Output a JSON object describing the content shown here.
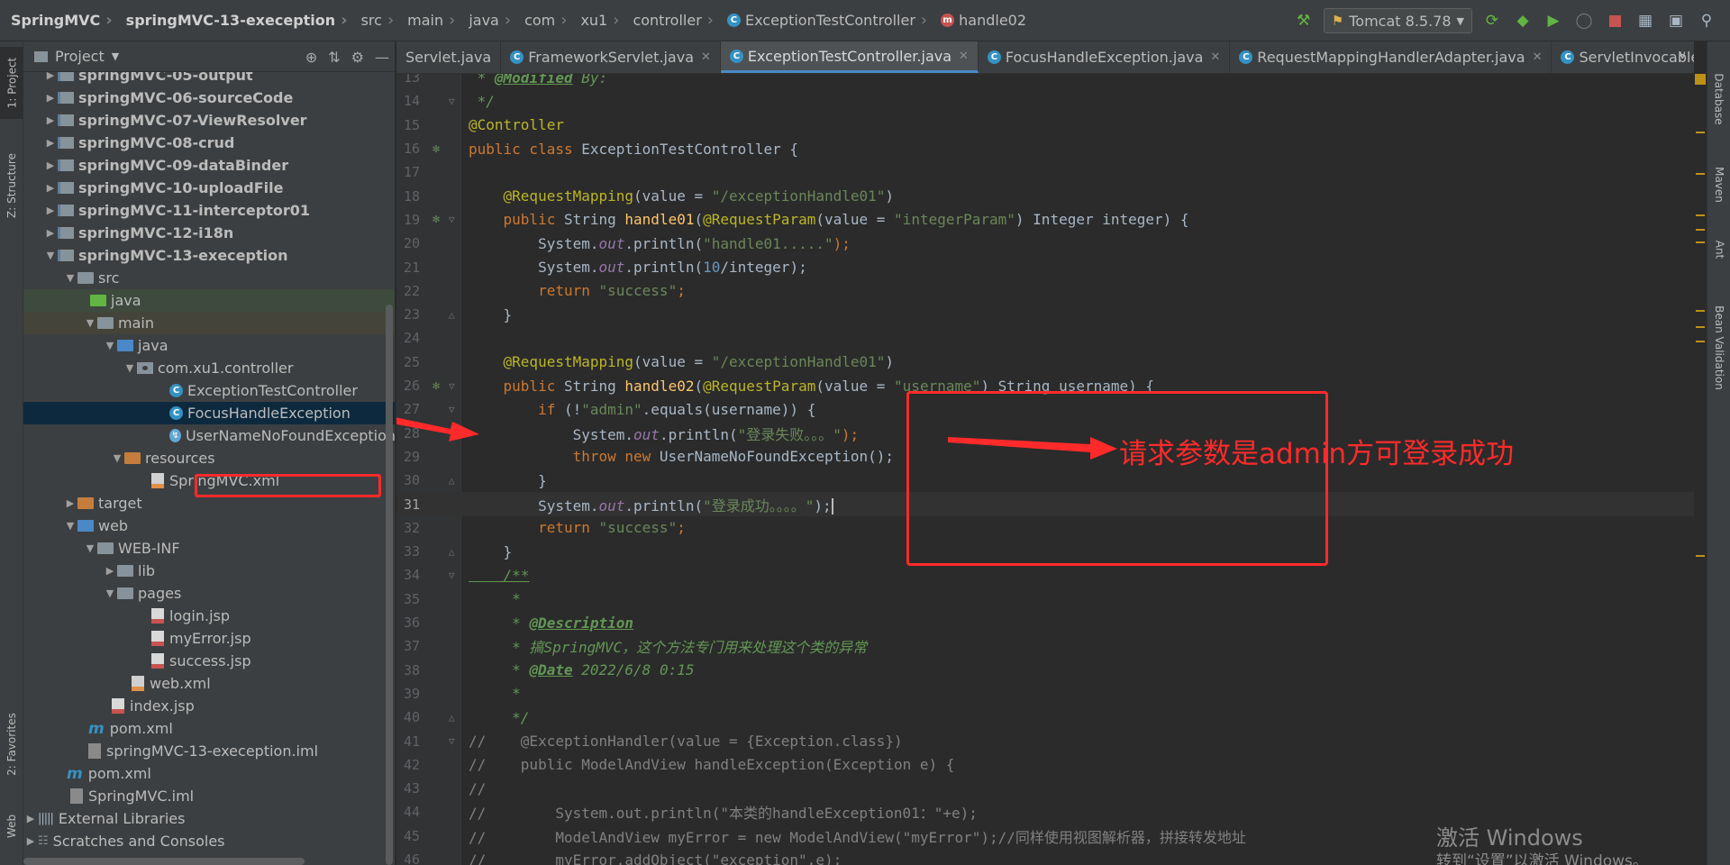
{
  "breadcrumbs": [
    "SpringMVC",
    "springMVC-13-exeception",
    "src",
    "main",
    "java",
    "com",
    "xu1",
    "controller",
    "ExceptionTestController",
    "handle02"
  ],
  "run_config": {
    "label": "Tomcat 8.5.78"
  },
  "project_panel": {
    "title": "Project"
  },
  "tool_windows": {
    "left": [
      "1: Project",
      "Z: Structure",
      "2: Favorites",
      "Web"
    ],
    "right": [
      "Database",
      "Maven",
      "Ant",
      "Bean Validation"
    ]
  },
  "tree": [
    {
      "label": "springMVC-05-output"
    },
    {
      "label": "springMVC-06-sourceCode"
    },
    {
      "label": "springMVC-07-ViewResolver"
    },
    {
      "label": "springMVC-08-crud"
    },
    {
      "label": "springMVC-09-dataBinder"
    },
    {
      "label": "springMVC-10-uploadFile"
    },
    {
      "label": "springMVC-11-interceptor01"
    },
    {
      "label": "springMVC-12-i18n"
    },
    {
      "label": "springMVC-13-exeception"
    },
    {
      "label": "src"
    },
    {
      "label": "java"
    },
    {
      "label": "main"
    },
    {
      "label": "java"
    },
    {
      "label": "com.xu1.controller"
    },
    {
      "label": "ExceptionTestController"
    },
    {
      "label": "FocusHandleException"
    },
    {
      "label": "UserNameNoFoundException"
    },
    {
      "label": "resources"
    },
    {
      "label": "SpringMVC.xml"
    },
    {
      "label": "target"
    },
    {
      "label": "web"
    },
    {
      "label": "WEB-INF"
    },
    {
      "label": "lib"
    },
    {
      "label": "pages"
    },
    {
      "label": "login.jsp"
    },
    {
      "label": "myError.jsp"
    },
    {
      "label": "success.jsp"
    },
    {
      "label": "web.xml"
    },
    {
      "label": "index.jsp"
    },
    {
      "label": "pom.xml"
    },
    {
      "label": "springMVC-13-exeception.iml"
    },
    {
      "label": "pom.xml"
    },
    {
      "label": "SpringMVC.iml"
    },
    {
      "label": "External Libraries"
    },
    {
      "label": "Scratches and Consoles"
    }
  ],
  "tabs": [
    {
      "label": "Servlet.java"
    },
    {
      "label": "FrameworkServlet.java"
    },
    {
      "label": "ExceptionTestController.java"
    },
    {
      "label": "FocusHandleException.java"
    },
    {
      "label": "RequestMappingHandlerAdapter.java"
    },
    {
      "label": "ServletInvocableHandle"
    }
  ],
  "code": {
    "line_numbers": [
      "13",
      "14",
      "15",
      "16",
      "17",
      "18",
      "19",
      "20",
      "21",
      "22",
      "23",
      "24",
      "25",
      "26",
      "27",
      "28",
      "29",
      "30",
      "31",
      "32",
      "33",
      "34",
      "35",
      "36",
      "37",
      "38",
      "39",
      "40",
      "41",
      "42",
      "43",
      "44",
      "45",
      "46"
    ],
    "l13a": " * ",
    "l13b": "@Modified",
    "l13c": " By:",
    "l14": " */",
    "l15": "@Controller",
    "l16a": "public class ",
    "l16b": "ExceptionTestController {",
    "l18a": "    ",
    "l18b": "@RequestMapping",
    "l18c": "(value = ",
    "l18d": "\"/exceptionHandle01\"",
    "l18e": ")",
    "l19a": "    public ",
    "l19b": "String ",
    "l19c": "handle01",
    "l19d": "(",
    "l19e": "@RequestParam",
    "l19f": "(value = ",
    "l19g": "\"integerParam\"",
    "l19h": ") Integer integer) {",
    "l20a": "        System.",
    "l20b": "out",
    "l20c": ".println(",
    "l20d": "\"handle01.....\"",
    "l20e": ");",
    "l21a": "        System.",
    "l21b": "out",
    "l21c": ".println(",
    "l21d": "10",
    "l21e": "/integer);",
    "l22a": "        return ",
    "l22b": "\"success\"",
    "l22c": ";",
    "l23": "    }",
    "l25a": "    ",
    "l25b": "@RequestMapping",
    "l25c": "(value = ",
    "l25d": "\"/exceptionHandle01\"",
    "l25e": ")",
    "l26a": "    public ",
    "l26b": "String ",
    "l26c": "handle02",
    "l26d": "(",
    "l26e": "@RequestParam",
    "l26f": "(value = ",
    "l26g": "\"username\"",
    "l26h": ") String username) {",
    "l27a": "        if ",
    "l27b": "(!",
    "l27c": "\"admin\"",
    "l27d": ".equals(username)) {",
    "l28a": "            System.",
    "l28b": "out",
    "l28c": ".println(",
    "l28d": "\"登录失败。。。\"",
    "l28e": ");",
    "l29a": "            throw new ",
    "l29b": "UserNameNoFoundException();",
    "l30": "        }",
    "l31a": "        System.",
    "l31b": "out",
    "l31c": ".println(",
    "l31d": "\"登录成功。。。。\"",
    "l31e": ");",
    "l32a": "        return ",
    "l32b": "\"success\"",
    "l32c": ";",
    "l33": "    }",
    "l34": "    /**",
    "l35": "     *",
    "l36a": "     * ",
    "l36b": "@Description",
    "l37": "     * 搞SpringMVC，这个方法专门用来处理这个类的异常",
    "l38a": "     * ",
    "l38b": "@Date",
    "l38c": " 2022/6/8 0:15",
    "l39": "     *",
    "l40": "     */",
    "l41": "//    @ExceptionHandler(value = {Exception.class})",
    "l42": "//    public ModelAndView handleException(Exception e) {",
    "l43": "//",
    "l44": "//        System.out.println(\"本类的handleException01：\"+e);",
    "l45": "//        ModelAndView myError = new ModelAndView(\"myError\");//同样使用视图解析器，拼接转发地址",
    "l46": "//        myError.addObject(\"exception\",e);"
  },
  "annotation": {
    "text": "请求参数是admin方可登录成功"
  },
  "watermark": {
    "line1": "激活 Windows",
    "line2": "转到“设置”以激活 Windows。"
  },
  "colors": {
    "accent": "#4a88c7",
    "annotation_red": "#ff2a2a",
    "editor_bg": "#2b2b2b"
  }
}
